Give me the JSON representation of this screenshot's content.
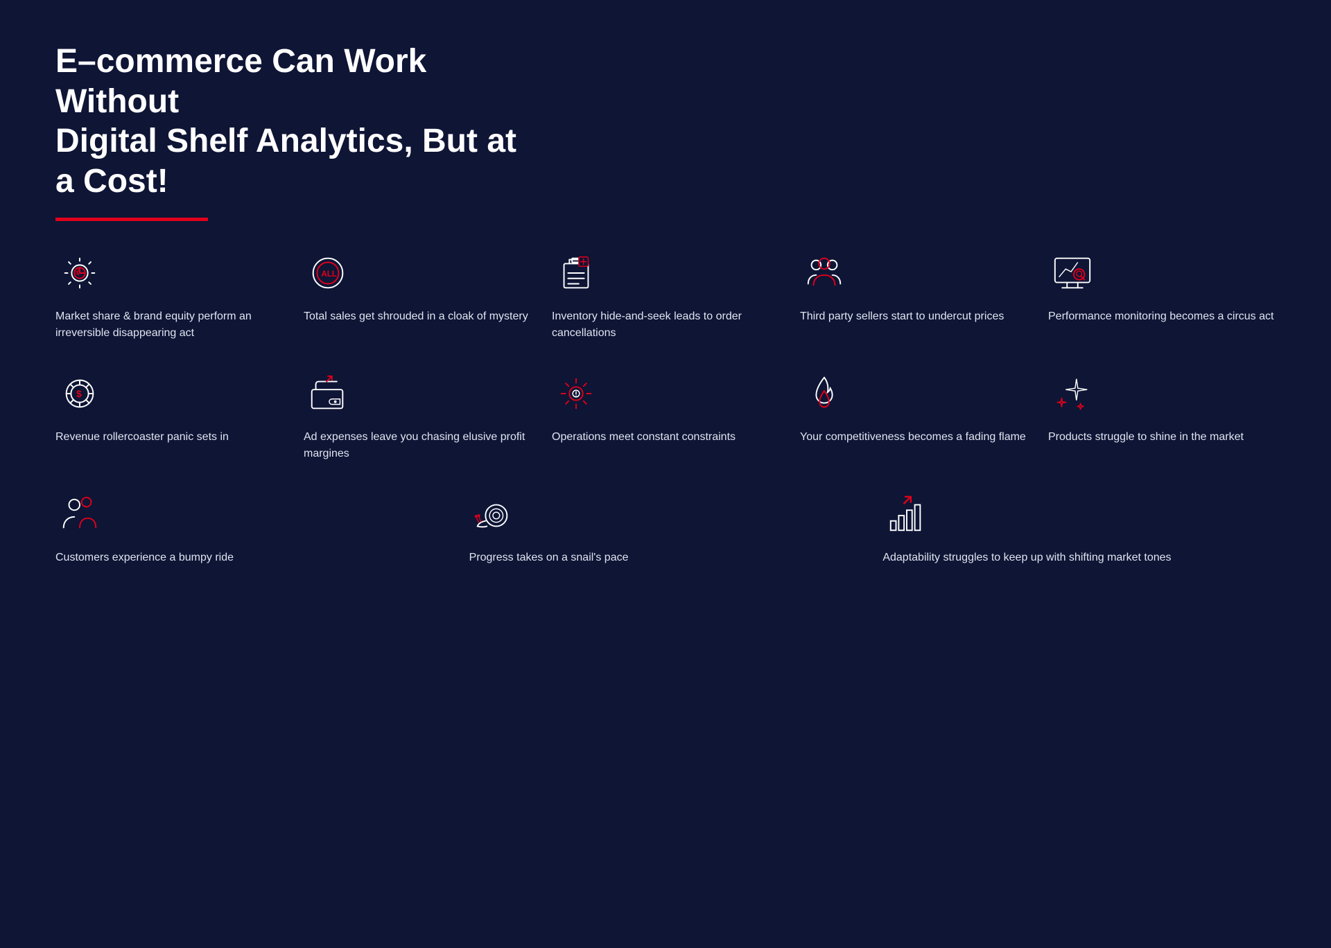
{
  "header": {
    "title_line1": "E–commerce Can Work Without",
    "title_line2": "Digital Shelf Analytics, But at a Cost!"
  },
  "items_row1": [
    {
      "id": "market-share",
      "label": "Market share & brand equity perform an irreversible disappearing act",
      "icon": "gear-chart"
    },
    {
      "id": "total-sales",
      "label": "Total sales get shrouded in a cloak of mystery",
      "icon": "all-circle"
    },
    {
      "id": "inventory",
      "label": "Inventory hide-and-seek leads to order cancellations",
      "icon": "clipboard-box"
    },
    {
      "id": "third-party",
      "label": "Third party sellers start to undercut prices",
      "icon": "people"
    },
    {
      "id": "performance",
      "label": "Performance monitoring becomes a circus act",
      "icon": "monitor-search"
    }
  ],
  "items_row2": [
    {
      "id": "revenue",
      "label": "Revenue rollercoaster panic sets in",
      "icon": "dollar-gear"
    },
    {
      "id": "ad-expenses",
      "label": "Ad expenses leave you chasing elusive profit margines",
      "icon": "wallet-arrow"
    },
    {
      "id": "operations",
      "label": "Operations meet constant constraints",
      "icon": "gear-warning"
    },
    {
      "id": "competitiveness",
      "label": "Your competitiveness becomes a fading flame",
      "icon": "flame"
    },
    {
      "id": "products",
      "label": "Products struggle to shine in the market",
      "icon": "sparkle"
    }
  ],
  "items_row3": [
    {
      "id": "customers",
      "label": "Customers experience a bumpy ride",
      "icon": "person-bump"
    },
    {
      "id": "progress",
      "label": "Progress takes on a snail's pace",
      "icon": "snail"
    },
    {
      "id": "adaptability",
      "label": "Adaptability struggles to keep up with shifting market tones",
      "icon": "chart-arrow"
    }
  ]
}
